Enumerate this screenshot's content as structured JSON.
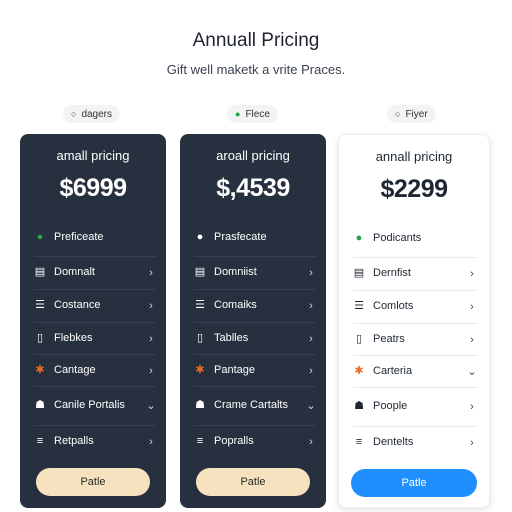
{
  "header": {
    "title": "Annuall Pricing",
    "subtitle": "Gift well maketk a vrite Praces."
  },
  "colors": {
    "dark_card": "#27303f",
    "light_card": "#ffffff",
    "accent_blue": "#1f8fff",
    "accent_cream": "#f6e2bf",
    "green": "#22a34a",
    "orange": "#ea6a2c"
  },
  "plans": [
    {
      "tag": "dagers",
      "name": "amall pricing",
      "price": "$6999",
      "highlight": "Preficeate",
      "rows": [
        "Domnalt",
        "Costance",
        "Flebkes",
        "Cantage",
        "Canile Portalis",
        "Retpalls"
      ],
      "button": "Patle"
    },
    {
      "tag": "Flece",
      "name": "aroall pricing",
      "price": "$,4539",
      "highlight": "Prasfecate",
      "rows": [
        "Domniist",
        "Comaiks",
        "Tablles",
        "Pantage",
        "Crame Cartalts",
        "Popralls"
      ],
      "button": "Patle"
    },
    {
      "tag": "Fiyer",
      "name": "annall pricing",
      "price": "$2299",
      "highlight": "Podicants",
      "rows": [
        "Dernfist",
        "Comlots",
        "Peatrs",
        "Carteria",
        "Poople",
        "Dentelts"
      ],
      "button": "Patle"
    }
  ]
}
